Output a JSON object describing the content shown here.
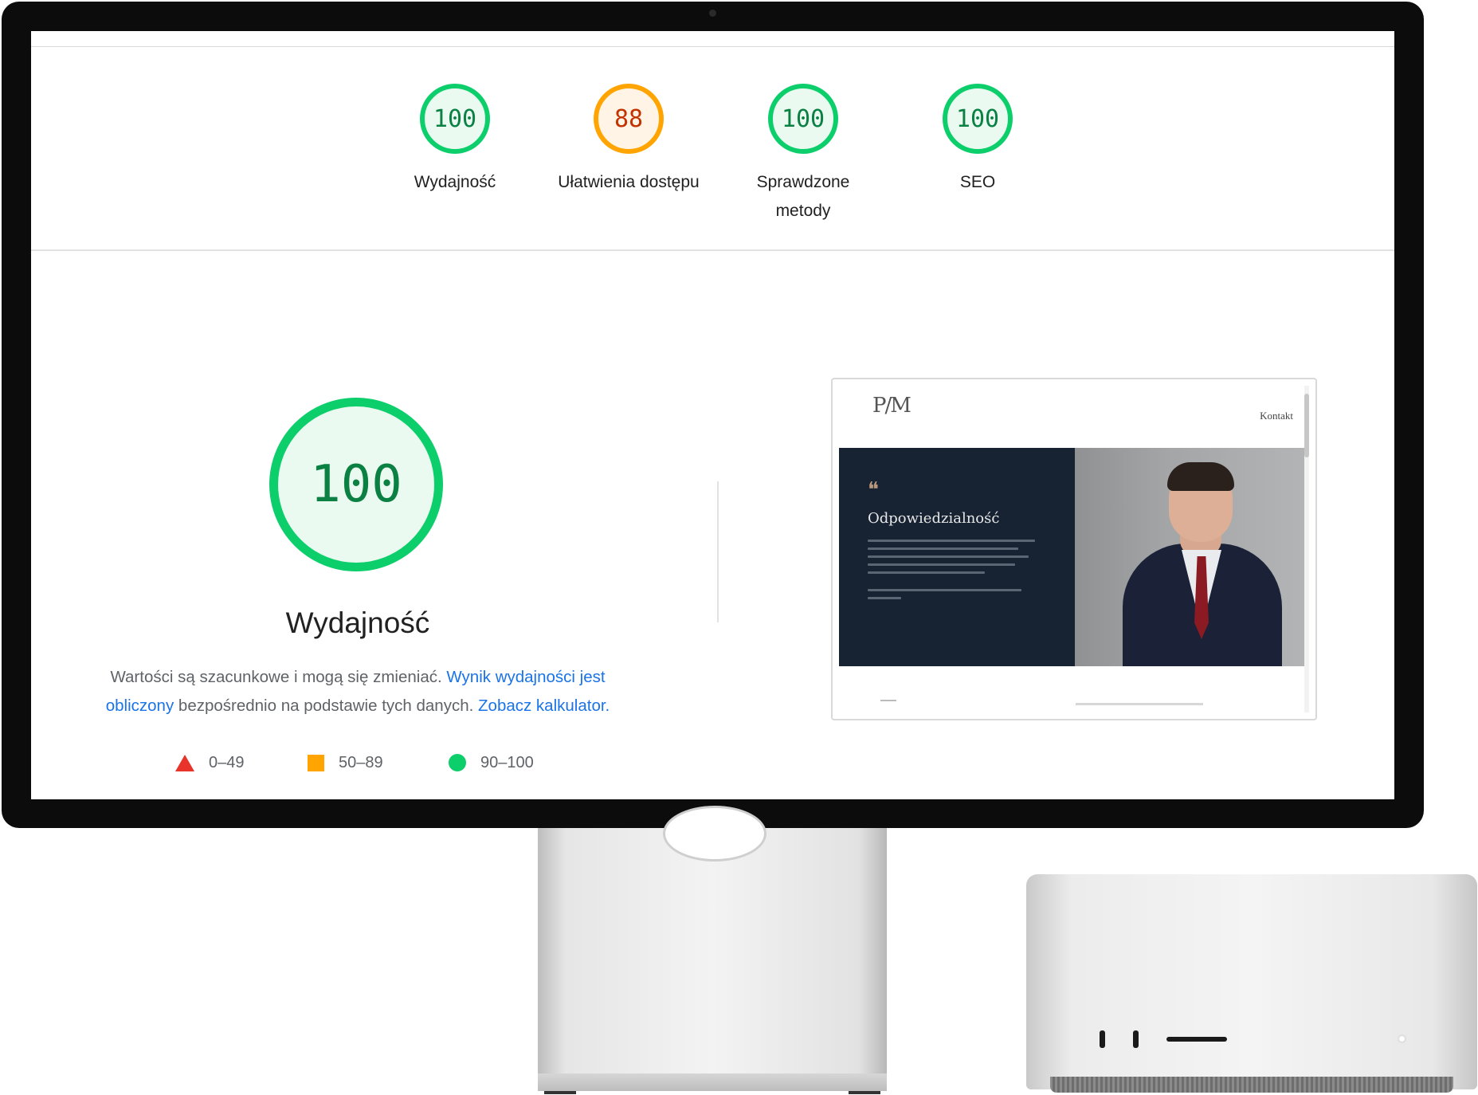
{
  "categories": [
    {
      "score": "100",
      "label": "Wydajność",
      "status": "pass"
    },
    {
      "score": "88",
      "label": "Ułatwienia dostępu",
      "status": "average"
    },
    {
      "score": "100",
      "label": "Sprawdzone metody",
      "status": "pass"
    },
    {
      "score": "100",
      "label": "SEO",
      "status": "pass"
    }
  ],
  "detail": {
    "score": "100",
    "title": "Wydajność",
    "description_prefix": "Wartości są szacunkowe i mogą się zmieniać.",
    "link1": "Wynik wydajności jest obliczony",
    "description_mid": "bezpośrednio na podstawie tych danych.",
    "link2": "Zobacz kalkulator."
  },
  "legend": [
    {
      "range": "0–49",
      "shape": "triangle",
      "color": "#e8332a"
    },
    {
      "range": "50–89",
      "shape": "square",
      "color": "#ffa400"
    },
    {
      "range": "90–100",
      "shape": "circle",
      "color": "#0cce6b"
    }
  ],
  "thumbnail": {
    "logo_mark": "P/M",
    "nav_link": "Kontakt",
    "heading": "Odpowiedzialność",
    "quote_icon": "quote-icon"
  },
  "colors": {
    "pass": "#0cce6b",
    "average": "#ffa400",
    "fail": "#e8332a",
    "link": "#1a73e8"
  }
}
